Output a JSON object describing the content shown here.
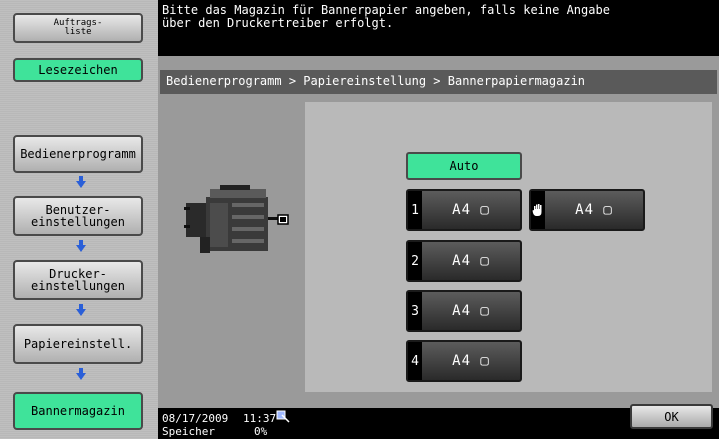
{
  "header": {
    "message": "Bitte das Magazin für Bannerpapier angeben, falls keine Angabe\nüber den Druckertreiber erfolgt."
  },
  "sidebar": {
    "job_list_label": "Auftrags-\nliste",
    "bookmark_label": "Lesezeichen",
    "nav": [
      {
        "label": "Bedienerprogramm"
      },
      {
        "label": "Benutzer-\neinstellungen"
      },
      {
        "label": "Drucker-\neinstellungen"
      },
      {
        "label": "Papiereinstell."
      },
      {
        "label": "Bannermagazin"
      }
    ]
  },
  "breadcrumb": "Bedienerprogramm > Papiereinstellung > Bannerpapiermagazin",
  "trays": {
    "auto_label": "Auto",
    "items": [
      {
        "number": "1",
        "paper": "A4 ▢"
      },
      {
        "number": "2",
        "paper": "A4 ▢"
      },
      {
        "number": "3",
        "paper": "A4 ▢"
      },
      {
        "number": "4",
        "paper": "A4 ▢"
      }
    ],
    "bypass": {
      "paper": "A4 ▢",
      "icon": "hand-icon"
    }
  },
  "status": {
    "date": "08/17/2009",
    "time": "11:37",
    "memory_label": "Speicher",
    "memory_value": "0%"
  },
  "ok_label": "OK",
  "colors": {
    "accent_green": "#3fe39a",
    "arrow_blue": "#2a5fd8"
  }
}
